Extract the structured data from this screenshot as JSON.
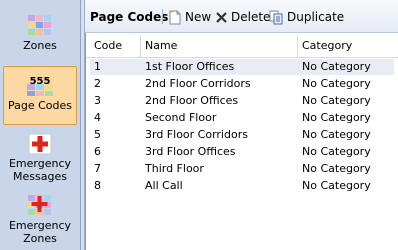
{
  "nav": {
    "items": [
      {
        "label": "Zones",
        "icon": "zones-icon"
      },
      {
        "label": "Page Codes",
        "icon": "page-codes-icon",
        "badge": "555"
      },
      {
        "label": "Emergency\nMessages",
        "icon": "emergency-messages-icon"
      },
      {
        "label": "Emergency\nZones",
        "icon": "emergency-zones-icon"
      }
    ],
    "active": "Page Codes"
  },
  "toolbar": {
    "title": "Page Codes",
    "new_label": "New",
    "delete_label": "Delete",
    "duplicate_label": "Duplicate"
  },
  "table": {
    "columns": [
      "Code",
      "Name",
      "Category"
    ],
    "rows": [
      {
        "code": "1",
        "name": "1st Floor Offices",
        "category": "No Category"
      },
      {
        "code": "2",
        "name": "2nd Floor Corridors",
        "category": "No Category"
      },
      {
        "code": "3",
        "name": "2nd Floor Offices",
        "category": "No Category"
      },
      {
        "code": "4",
        "name": "Second Floor",
        "category": "No Category"
      },
      {
        "code": "5",
        "name": "3rd Floor Corridors",
        "category": "No Category"
      },
      {
        "code": "6",
        "name": "3rd Floor Offices",
        "category": "No Category"
      },
      {
        "code": "7",
        "name": "Third Floor",
        "category": "No Category"
      },
      {
        "code": "8",
        "name": "All Call",
        "category": "No Category"
      }
    ]
  },
  "colors": {
    "nav_bg": "#c9d5e8",
    "active_bg": "#fcd9a2",
    "active_border": "#e29a3c",
    "emergency_red": "#e2231a"
  }
}
